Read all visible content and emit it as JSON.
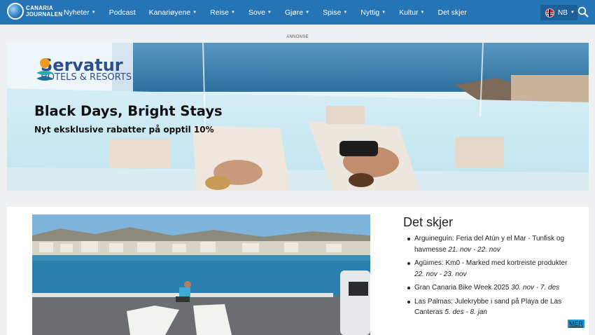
{
  "header": {
    "logo_line1": "CANARIA",
    "logo_line2": "JOURNALEN",
    "nav": [
      {
        "label": "Nyheter",
        "dropdown": true
      },
      {
        "label": "Podcast",
        "dropdown": false
      },
      {
        "label": "Kanariøyene",
        "dropdown": true
      },
      {
        "label": "Reise",
        "dropdown": true
      },
      {
        "label": "Sove",
        "dropdown": true
      },
      {
        "label": "Gjøre",
        "dropdown": true
      },
      {
        "label": "Spise",
        "dropdown": true
      },
      {
        "label": "Nyttig",
        "dropdown": true
      },
      {
        "label": "Kultur",
        "dropdown": true
      },
      {
        "label": "Det skjer",
        "dropdown": false
      }
    ],
    "language": "NB",
    "icons": {
      "language_flag": "norway-flag-icon",
      "search": "search-icon"
    }
  },
  "ad": {
    "label": "ANNONSE",
    "brand_name": "Servatur",
    "brand_sub": "HOTELS & RESORTS",
    "headline": "Black Days, Bright Stays",
    "subheadline": "Nyt eksklusive rabatter på opptil 10%"
  },
  "events": {
    "title": "Det skjer",
    "items": [
      {
        "text": "Arguineguín: Feria del Atún y el Mar - Tunfisk og havmesse",
        "date": "21. nov - 22. nov"
      },
      {
        "text": "Agüimes: Km0 - Marked med kortreiste produkter",
        "date": "22. nov - 23. nov"
      },
      {
        "text": "Gran Canaria Bike Week 2025",
        "date": "30. nov - 7. des"
      },
      {
        "text": "Las Palmas: Julekrybbe i sand på Playa de Las Canteras",
        "date": "5. des - 8. jan"
      }
    ],
    "more_label": "MER"
  },
  "colors": {
    "nav_bg": "#2474b6",
    "accent": "#1d93d0",
    "brand": "#2b4e8c"
  }
}
